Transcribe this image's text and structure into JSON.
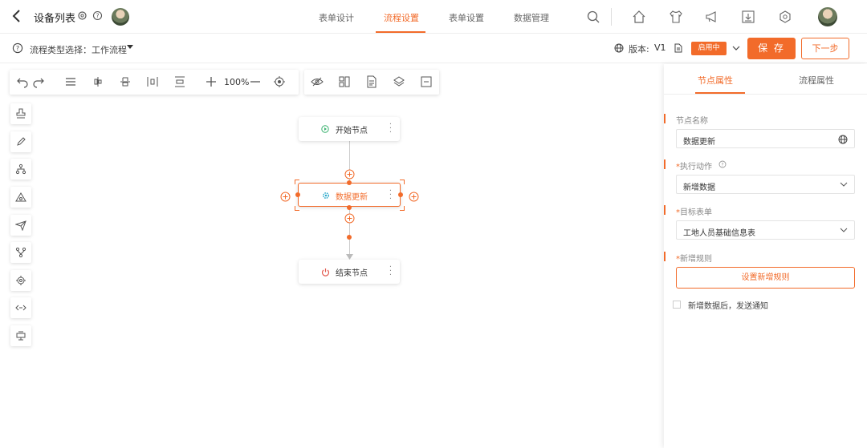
{
  "header": {
    "title": "设备列表",
    "tabs": [
      {
        "label": "表单设计"
      },
      {
        "label": "流程设置"
      },
      {
        "label": "表单设置"
      },
      {
        "label": "数据管理"
      }
    ]
  },
  "subbar": {
    "flow_type_label": "流程类型选择：工作流程",
    "version_label": "版本:",
    "version_value": "V1",
    "status_badge": "启用中",
    "save_label": "保 存",
    "next_label": "下一步"
  },
  "toolbar": {
    "zoom": "100%"
  },
  "canvas": {
    "start_node": "开始节点",
    "update_node": "数据更新",
    "end_node": "结束节点"
  },
  "panel": {
    "tabs": [
      {
        "label": "节点属性"
      },
      {
        "label": "流程属性"
      }
    ],
    "node_name_label": "节点名称",
    "node_name_value": "数据更新",
    "action_label": "执行动作",
    "action_value": "新增数据",
    "target_label": "目标表单",
    "target_value": "工地人员基础信息表",
    "rule_label": "新增规则",
    "rule_button": "设置新增规则",
    "notify_label": "新增数据后，发送通知"
  },
  "colors": {
    "accent": "#f26b2a"
  }
}
